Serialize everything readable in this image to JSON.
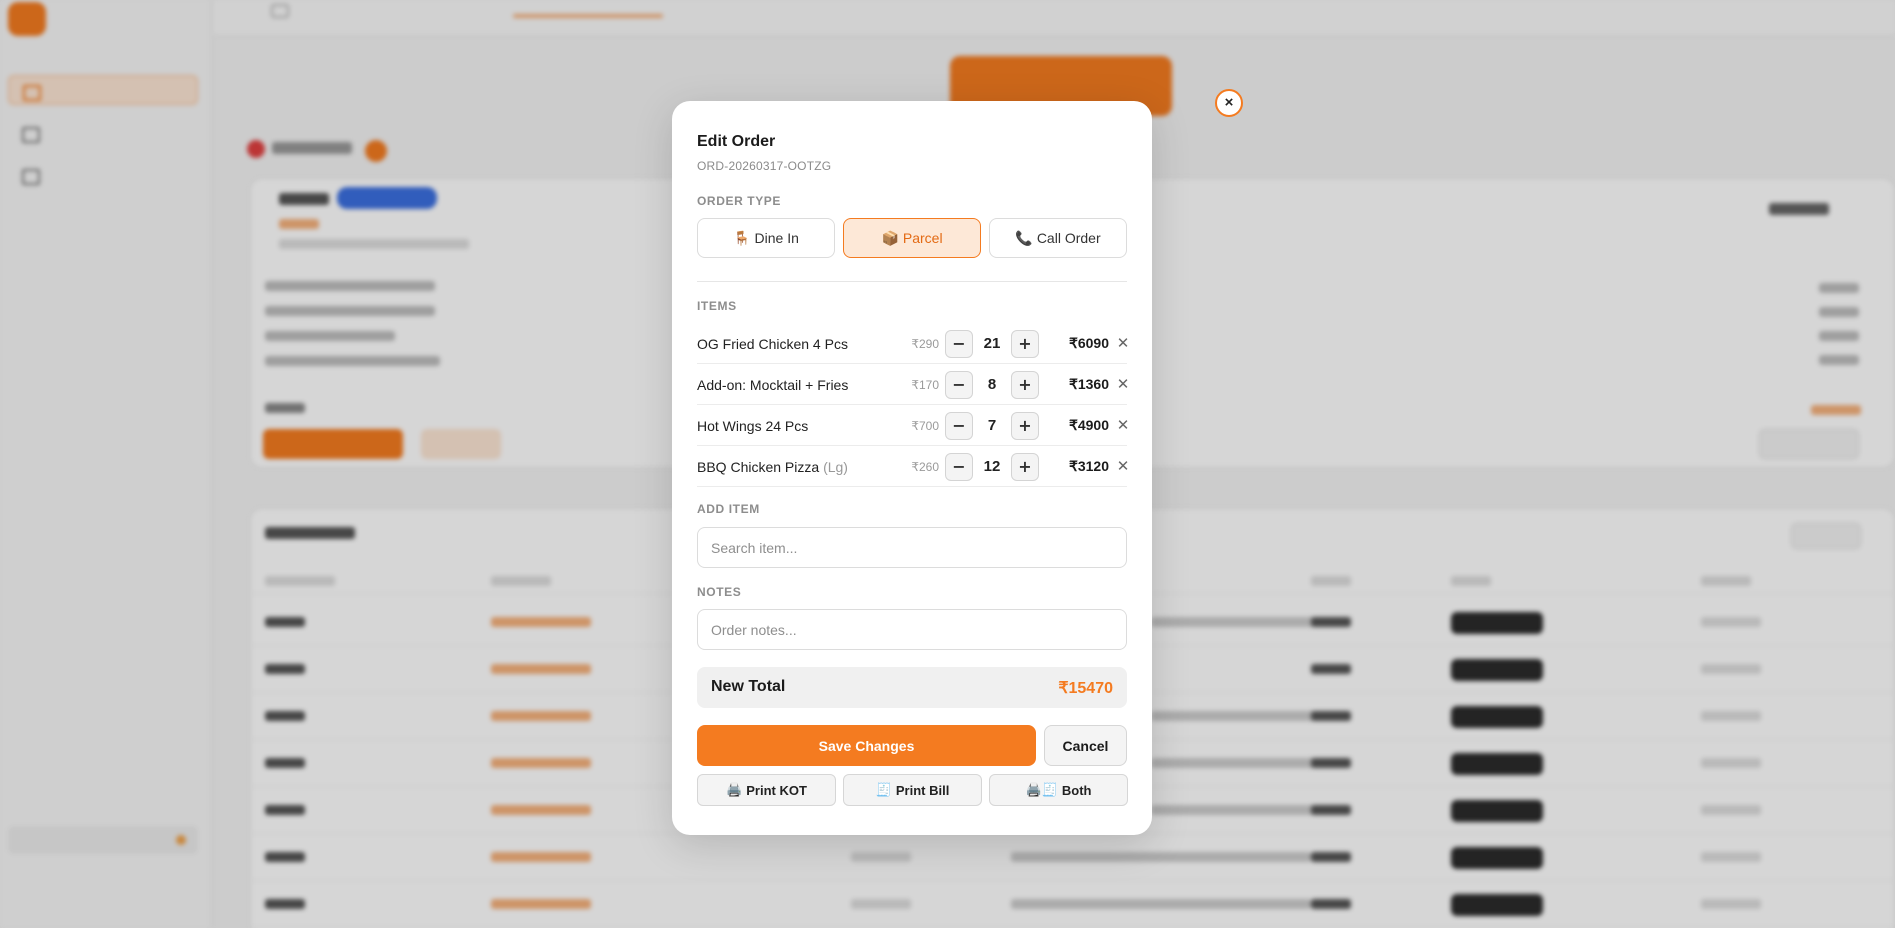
{
  "modal": {
    "title": "Edit Order",
    "order_id": "ORD-20260317-OOTZG",
    "close_label": "×",
    "order_type": {
      "label": "ORDER TYPE",
      "options": [
        {
          "icon": "🪑",
          "label": "Dine In",
          "selected": false
        },
        {
          "icon": "📦",
          "label": "Parcel",
          "selected": true
        },
        {
          "icon": "📞",
          "label": "Call Order",
          "selected": false
        }
      ]
    },
    "items": {
      "label": "ITEMS",
      "rows": [
        {
          "name": "OG Fried Chicken 4 Pcs",
          "size": "",
          "unit_price": "₹290",
          "qty": "21",
          "total": "₹6090"
        },
        {
          "name": "Add-on: Mocktail + Fries",
          "size": "",
          "unit_price": "₹170",
          "qty": "8",
          "total": "₹1360"
        },
        {
          "name": "Hot Wings 24 Pcs",
          "size": "",
          "unit_price": "₹700",
          "qty": "7",
          "total": "₹4900"
        },
        {
          "name": "BBQ Chicken Pizza",
          "size": "(Lg)",
          "unit_price": "₹260",
          "qty": "12",
          "total": "₹3120"
        }
      ],
      "minus_symbol": "−",
      "plus_symbol": "+",
      "remove_symbol": "✕"
    },
    "add_item": {
      "label": "ADD ITEM",
      "placeholder": "Search item..."
    },
    "notes": {
      "label": "NOTES",
      "placeholder": "Order notes..."
    },
    "new_total": {
      "label": "New Total",
      "value": "₹15470"
    },
    "save_label": "Save Changes",
    "cancel_label": "Cancel",
    "print": [
      {
        "icon": "🖨️",
        "label": "Print KOT"
      },
      {
        "icon": "🧾",
        "label": "Print Bill"
      },
      {
        "icon": "🖨️🧾",
        "label": "Both"
      }
    ]
  },
  "colors": {
    "accent": "#f47b20",
    "accent_light": "#fde8d7",
    "overlay": "rgba(0,0,0,0.16)"
  }
}
